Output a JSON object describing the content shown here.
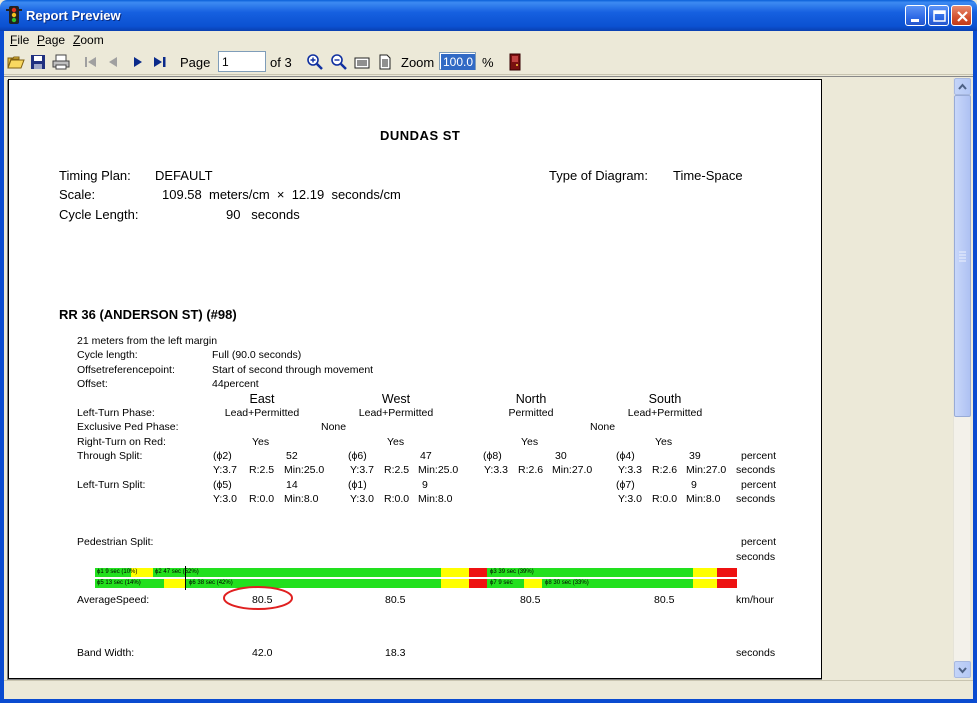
{
  "window": {
    "title": "Report Preview"
  },
  "menu": [
    {
      "label": "File",
      "hotkey": "F",
      "rest": "ile"
    },
    {
      "label": "Page",
      "hotkey": "P",
      "rest": "age"
    },
    {
      "label": "Zoom",
      "hotkey": "Z",
      "rest": "oom"
    }
  ],
  "toolbar": {
    "page_label": "Page",
    "page_value": "1",
    "page_of": "of 3",
    "zoom_label": "Zoom",
    "zoom_value": "100.0",
    "zoom_unit": "%"
  },
  "report": {
    "title": "DUNDAS ST",
    "timing_plan_label": "Timing Plan:",
    "timing_plan_value": "DEFAULT",
    "diagram_type_label": "Type of Diagram:",
    "diagram_type_value": "Time-Space",
    "scale_label": "Scale:",
    "scale_value": "109.58  meters/cm  ×  12.19  seconds/cm",
    "cycle_label": "Cycle Length:",
    "cycle_value": "90   seconds",
    "intersection_title": "RR 36 (ANDERSON ST) (#98)",
    "distance": "21 meters from the left margin",
    "cycle_length_label": "Cycle length:",
    "cycle_length_value": "Full (90.0 seconds)",
    "offset_ref_label": "Offsetreferencepoint:",
    "offset_ref_value": "Start of second through movement",
    "offset_label": "Offset:",
    "offset_value": "44percent",
    "directions": [
      "East",
      "West",
      "North",
      "South"
    ],
    "left_turn_phase_label": "Left-Turn  Phase:",
    "left_turn_phase": [
      "Lead+Permitted",
      "Lead+Permitted",
      "Permitted",
      "Lead+Permitted"
    ],
    "excl_ped_label": "Exclusive Ped Phase:",
    "excl_ped": [
      "None",
      "None"
    ],
    "rtor_label": "Right-Turn on Red:",
    "rtor": [
      "Yes",
      "Yes",
      "Yes",
      "Yes"
    ],
    "through_label": "Through Split:",
    "through": [
      {
        "phase": "(ϕ2)",
        "split": "52",
        "detail_y": "Y:3.7",
        "detail_r": "R:2.5",
        "detail_min": "Min:25.0"
      },
      {
        "phase": "(ϕ6)",
        "split": "47",
        "detail_y": "Y:3.7",
        "detail_r": "R:2.5",
        "detail_min": "Min:25.0"
      },
      {
        "phase": "(ϕ8)",
        "split": "30",
        "detail_y": "Y:3.3",
        "detail_r": "R:2.6",
        "detail_min": "Min:27.0"
      },
      {
        "phase": "(ϕ4)",
        "split": "39",
        "detail_y": "Y:3.3",
        "detail_r": "R:2.6",
        "detail_min": "Min:27.0"
      }
    ],
    "left_turn_split_label": "Left-Turn  Split:",
    "left_split": [
      {
        "phase": "(ϕ5)",
        "split": "14",
        "detail_y": "Y:3.0",
        "detail_r": "R:0.0",
        "detail_min": "Min:8.0"
      },
      {
        "phase": "(ϕ1)",
        "split": "9",
        "detail_y": "Y:3.0",
        "detail_r": "R:0.0",
        "detail_min": "Min:8.0"
      },
      {
        "phase": "(ϕ7)",
        "split": "9",
        "detail_y": "Y:3.0",
        "detail_r": "R:0.0",
        "detail_min": "Min:8.0"
      }
    ],
    "unit_percent": "percent",
    "unit_seconds": "seconds",
    "ped_split_label": "Pedestrian Split:",
    "avg_speed_label": "AverageSpeed:",
    "avg_speed": [
      "80.5",
      "80.5",
      "80.5",
      "80.5"
    ],
    "speed_unit": "km/hour",
    "band_width_label": "Band Width:",
    "band_width": [
      "42.0",
      "18.3"
    ],
    "bar_labels": {
      "top_a": "ϕ1 9 sec (10%)",
      "top_b": "ϕ2 47 sec (52%)",
      "top_c": "ϕ3 39 sec (39%)",
      "bot_a": "ϕ5 13 sec (14%)",
      "bot_b": "ϕ6 38 sec (42%)",
      "bot_c": "ϕ7 9 sec",
      "bot_d": "ϕ8 30 sec (33%)"
    },
    "colors": {
      "green": "#22E01E",
      "yellow": "#FFFF00",
      "red": "#EE1111",
      "highlight_circle": "#E02020"
    }
  }
}
